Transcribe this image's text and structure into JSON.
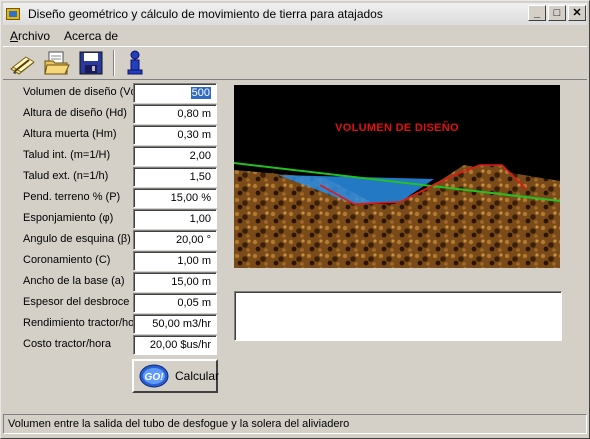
{
  "window": {
    "title": "Diseño geométrico y cálculo de movimiento de tierra para atajados",
    "minimize_glyph": "_",
    "maximize_glyph": "□",
    "close_glyph": "✕"
  },
  "menu": {
    "items": [
      {
        "label": "Archivo",
        "accel": "A",
        "rest": "rchivo"
      },
      {
        "label": "Acerca de",
        "accel": "",
        "rest": "Acerca de"
      }
    ]
  },
  "toolbar": {
    "icons": [
      "pencil-icon",
      "open-folder-icon",
      "save-disk-icon",
      "info-person-icon"
    ]
  },
  "form": {
    "fields": [
      {
        "label": "Volumen de diseño (Vd)",
        "value": "500",
        "selected": true
      },
      {
        "label": "Altura de diseño  (Hd)",
        "value": "0,80 m"
      },
      {
        "label": "Altura muerta (Hm)",
        "value": "0,30 m"
      },
      {
        "label": "Talud int. (m=1/H)",
        "value": "2,00"
      },
      {
        "label": "Talud ext. (n=1/h)",
        "value": "1,50"
      },
      {
        "label": "Pend. terreno % (P)",
        "value": "15,00 %"
      },
      {
        "label": "Esponjamiento (φ)",
        "value": "1,00"
      },
      {
        "label": "Angulo de esquina (β)",
        "value": "20,00 °"
      },
      {
        "label": "Coronamiento (C)",
        "value": "1,00 m"
      },
      {
        "label": "Ancho de la base (a)",
        "value": "15,00 m"
      },
      {
        "label": "Espesor del desbroce (z)",
        "value": "0,05 m"
      },
      {
        "label": "Rendimiento tractor/hora",
        "value": "50,00 m3/hr"
      },
      {
        "label": "Costo tractor/hora",
        "value": "20,00 $us/hr"
      }
    ]
  },
  "calculate_button": {
    "icon_text": "GO!",
    "label": "Calcular"
  },
  "scene": {
    "title": "VOLUMEN DE DISEÑO"
  },
  "result": {
    "text": ""
  },
  "status": {
    "text": "Volumen entre la salida del tubo de desfogue y la solera del aliviadero"
  }
}
